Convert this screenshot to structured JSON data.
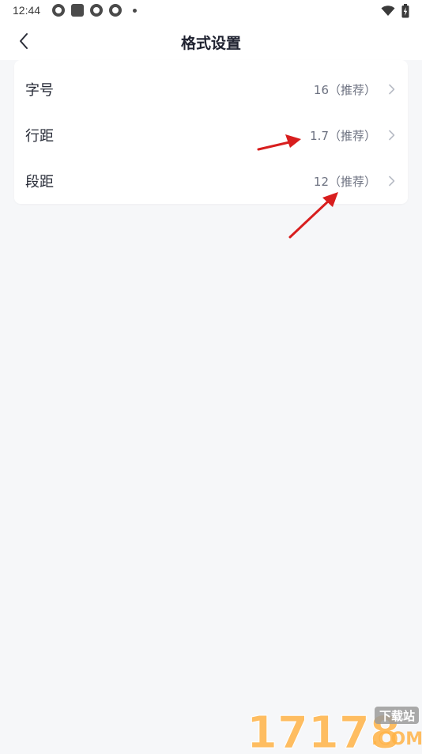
{
  "status_bar": {
    "time": "12:44"
  },
  "nav": {
    "title": "格式设置"
  },
  "settings": {
    "rows": [
      {
        "label": "字号",
        "value": "16（推荐）"
      },
      {
        "label": "行距",
        "value": "1.7（推荐）"
      },
      {
        "label": "段距",
        "value": "12（推荐）"
      }
    ]
  },
  "watermark": {
    "number_text": "17178",
    "site_text": "下载站",
    "domain_text": ".COM"
  },
  "colors": {
    "background": "#f6f7f9",
    "card": "#ffffff",
    "arrow_red": "#d81e1e"
  }
}
